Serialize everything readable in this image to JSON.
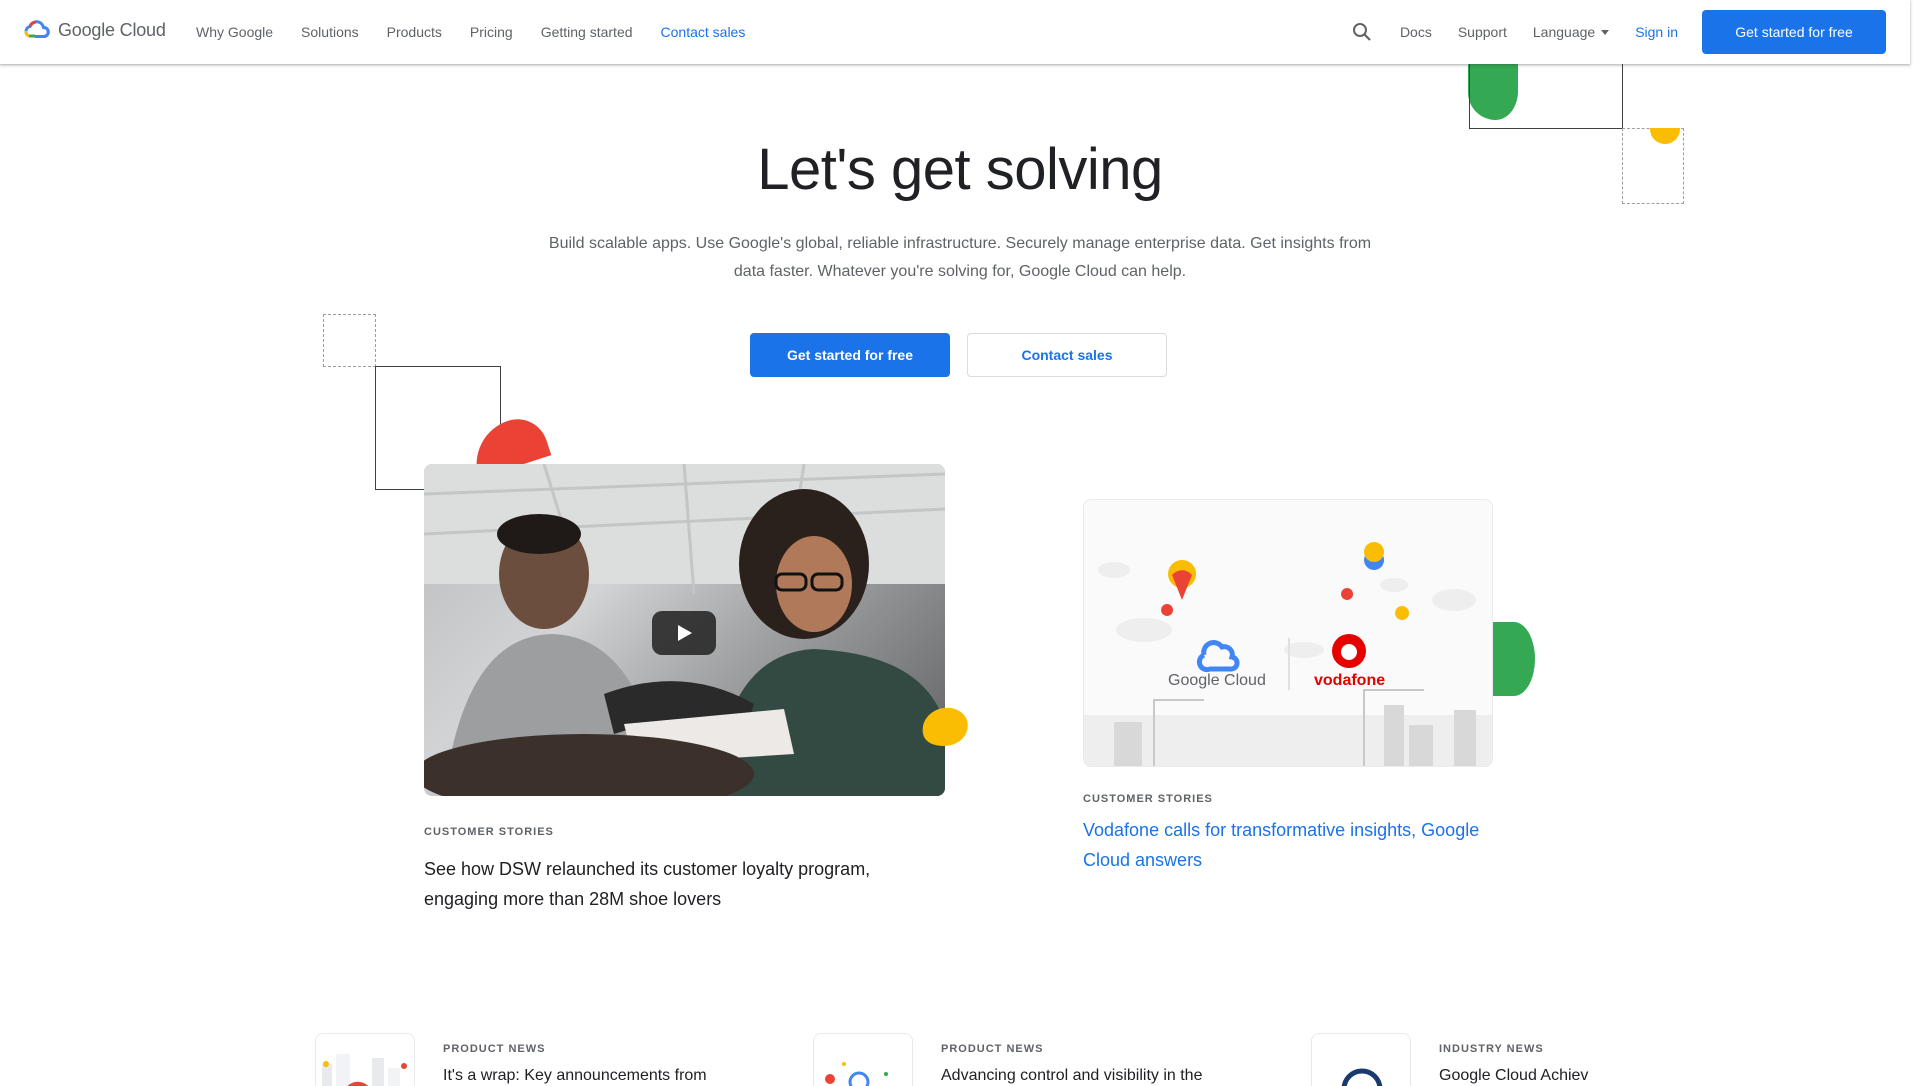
{
  "header": {
    "brand": "Google Cloud",
    "nav": [
      "Why Google",
      "Solutions",
      "Products",
      "Pricing",
      "Getting started",
      "Contact sales"
    ],
    "active_nav_index": 5,
    "right": {
      "docs": "Docs",
      "support": "Support",
      "language": "Language",
      "signin": "Sign in",
      "cta": "Get started for free"
    }
  },
  "hero": {
    "title": "Let's get solving",
    "subtitle": "Build scalable apps. Use Google's global, reliable infrastructure. Securely manage enterprise data. Get insights from data faster. Whatever you're solving for, Google Cloud can help.",
    "primary_button": "Get started for free",
    "secondary_button": "Contact sales"
  },
  "featured": [
    {
      "eyebrow": "CUSTOMER STORIES",
      "title": "See how DSW relaunched its customer loyalty program, engaging more than 28M shoe lovers"
    },
    {
      "eyebrow": "CUSTOMER STORIES",
      "title": "Vodafone calls for transformative insights, Google Cloud answers",
      "logo_left": "Google Cloud",
      "logo_right": "vodafone"
    }
  ],
  "news": [
    {
      "eyebrow": "PRODUCT NEWS",
      "title": "It's a wrap: Key announcements from"
    },
    {
      "eyebrow": "PRODUCT NEWS",
      "title": "Advancing control and visibility in the"
    },
    {
      "eyebrow": "INDUSTRY NEWS",
      "title": "Google Cloud Achiev"
    }
  ],
  "colors": {
    "blue": "#1a73e8",
    "red": "#ea4335",
    "yellow": "#fbbc04",
    "green": "#34a853",
    "vodafone_red": "#e60000"
  }
}
